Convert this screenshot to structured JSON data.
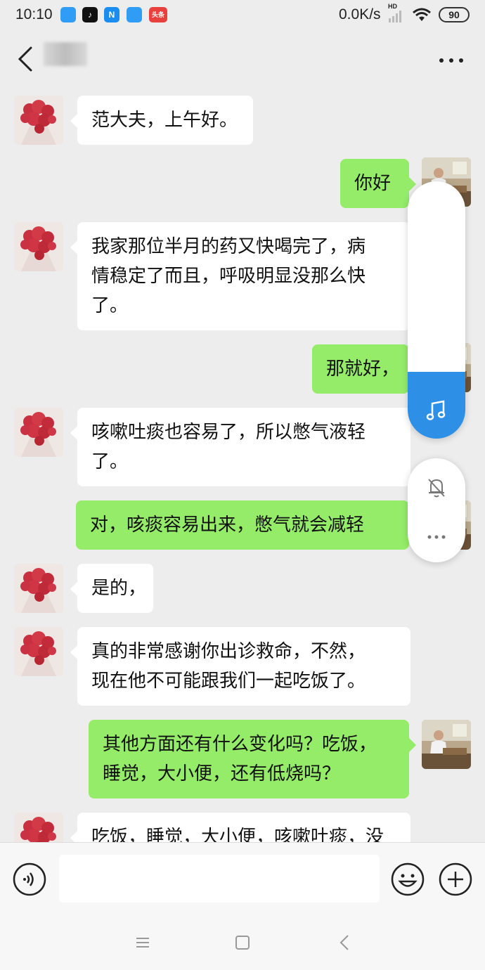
{
  "status_bar": {
    "time": "10:10",
    "apps": [
      {
        "name": "app-blue-1",
        "color": "#2f9cf5",
        "glyph": ""
      },
      {
        "name": "tiktok",
        "color": "#111111",
        "glyph": "♪"
      },
      {
        "name": "app-n",
        "color": "#1a8df0",
        "glyph": "N"
      },
      {
        "name": "app-blue-2",
        "color": "#2f9cf5",
        "glyph": ""
      },
      {
        "name": "toutiao",
        "color": "#e8403c",
        "glyph": "头条"
      }
    ],
    "network_speed": "0.0K/s",
    "network_hd": "HD",
    "battery": "90"
  },
  "chat": {
    "messages": [
      {
        "side": "left",
        "avatar": "flower-bouquet",
        "lines": [
          "范大夫，上午好。"
        ]
      },
      {
        "side": "right",
        "avatar": "doctor-photo",
        "lines": [
          "你好"
        ]
      },
      {
        "side": "left",
        "avatar": "flower-bouquet",
        "lines": [
          "我家那位半月的药又快喝完了，病",
          "情稳定了而且，呼吸明显没那么快",
          "了。"
        ]
      },
      {
        "side": "right",
        "avatar": "doctor-photo",
        "lines": [
          "那就好，"
        ]
      },
      {
        "side": "left",
        "avatar": "flower-bouquet",
        "lines": [
          "咳嗽吐痰也容易了，所以憋气液轻",
          "了。"
        ]
      },
      {
        "side": "right",
        "avatar": "doctor-photo",
        "lines": [
          "对，咳痰容易出来，憋气就会减轻"
        ]
      },
      {
        "side": "left",
        "avatar": "flower-bouquet",
        "lines": [
          "是的，"
        ]
      },
      {
        "side": "left",
        "avatar": "flower-bouquet",
        "lines": [
          "真的非常感谢你出诊救命，不然，",
          "现在他不可能跟我们一起吃饭了。"
        ]
      },
      {
        "side": "right",
        "avatar": "doctor-photo",
        "lines": [
          "其他方面还有什么变化吗？吃饭，",
          "睡觉，大小便，还有低烧吗？"
        ]
      },
      {
        "side": "left",
        "avatar": "flower-bouquet",
        "lines": [
          "吃饭，睡觉，大小便，咳嗽吐痰，没"
        ]
      }
    ]
  },
  "floating_controls": {
    "volume_level": 0.26,
    "volume_color": "#2e8fe6",
    "media_icon": "music-note-icon",
    "mute_icon": "bell-off-icon",
    "more_icon": "more-dots-icon"
  },
  "input_bar": {
    "placeholder": "",
    "icons": [
      "voice-icon",
      "emoji-icon",
      "plus-icon"
    ]
  },
  "system_nav": {
    "icons": [
      "menu-icon",
      "home-icon",
      "back-icon"
    ]
  },
  "watermark": "⁢⁢⁢⁢⁢⁢⁢⁢⁢⁢⁢⁢⁢⁢⁢"
}
